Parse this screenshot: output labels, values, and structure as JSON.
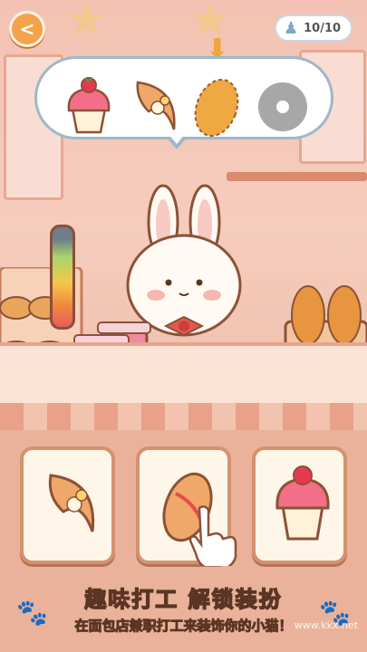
{
  "header": {
    "back_symbol": "<",
    "counter": "10/10"
  },
  "order_bubble": {
    "items": [
      "cupcake-icon",
      "croissant-icon",
      "bread-loaf-icon",
      "donut-icon"
    ],
    "selected_index": 2
  },
  "choices": [
    "croissant-icon",
    "bread-loaf-icon",
    "cupcake-icon"
  ],
  "banner": {
    "title": "趣味打工 解锁装扮",
    "subtitle": "在面包店兼职打工来装饰你的小猫！"
  },
  "watermark": "www.kkx.net",
  "colors": {
    "accent": "#f5a24a",
    "outline": "#5b3524",
    "bubble_border": "#9fb7c9"
  }
}
